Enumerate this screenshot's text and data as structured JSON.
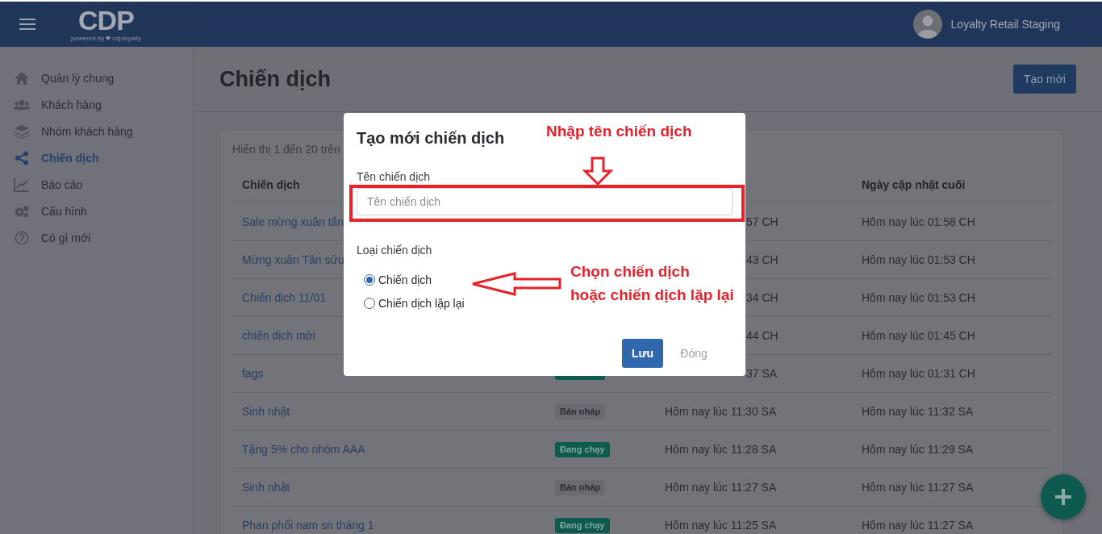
{
  "header": {
    "logo": "CDP",
    "tagline_prefix": "powered by",
    "tagline_brand": "cdployalty",
    "user": "Loyalty Retail Staging"
  },
  "sidebar": {
    "items": [
      {
        "label": "Quản lý chung",
        "selected": false
      },
      {
        "label": "Khách hàng",
        "selected": false
      },
      {
        "label": "Nhóm khách hàng",
        "selected": false
      },
      {
        "label": "Chiến dịch",
        "selected": true
      },
      {
        "label": "Báo cáo",
        "selected": false
      },
      {
        "label": "Cấu hình",
        "selected": false
      },
      {
        "label": "Có gì mới",
        "selected": false
      }
    ]
  },
  "page": {
    "title": "Chiến dịch",
    "create_button": "Tạo mới"
  },
  "table": {
    "summary": "Hiển thị 1 đến 20 trên",
    "columns": [
      "Chiến dịch",
      "",
      "",
      "Ngày cập nhật cuối"
    ],
    "rows": [
      {
        "name": "Sale mừng xuân tân",
        "created": "57 CH",
        "created_partial": true,
        "updated": "Hôm nay lúc 01:58 CH"
      },
      {
        "name": "Mừng xuân Tân sửu",
        "created": "43 CH",
        "created_partial": true,
        "updated": "Hôm nay lúc 01:53 CH"
      },
      {
        "name": "Chiến dịch 11/01",
        "created": "34 CH",
        "created_partial": true,
        "updated": "Hôm nay lúc 01:53 CH"
      },
      {
        "name": "chiến dịch mới",
        "created": "44 CH",
        "created_partial": true,
        "updated": "Hôm nay lúc 01:45 CH"
      },
      {
        "name": "fags",
        "status": {
          "kind": "running"
        },
        "created": "37 SA",
        "created_partial": true,
        "updated": "Hôm nay lúc 01:31 CH"
      },
      {
        "name": "Sinh nhật",
        "status": {
          "kind": "draft",
          "label": "Bản nháp"
        },
        "created": "Hôm nay lúc 11:30 SA",
        "created_partial": false,
        "updated": "Hôm nay lúc 11:32 SA"
      },
      {
        "name": "Tặng 5% cho nhóm AAA",
        "status": {
          "kind": "running",
          "label": "Đang chạy"
        },
        "created": "Hôm nay lúc 11:28 SA",
        "created_partial": false,
        "updated": "Hôm nay lúc 11:29 SA"
      },
      {
        "name": "Sinh nhật",
        "status": {
          "kind": "draft",
          "label": "Bản nháp"
        },
        "created": "Hôm nay lúc 11:27 SA",
        "created_partial": false,
        "updated": "Hôm nay lúc 11:27 SA"
      },
      {
        "name": "Phan phối nam sn tháng 1",
        "status": {
          "kind": "running",
          "label": "Đang chạy"
        },
        "created": "Hôm nay lúc 11:25 SA",
        "created_partial": false,
        "updated": "Hôm nay lúc 11:27 SA"
      }
    ]
  },
  "modal": {
    "title": "Tạo mới chiến dịch",
    "name_label": "Tên chiến dịch",
    "name_placeholder": "Tên chiến dịch",
    "type_label": "Loại chiến dịch",
    "options": [
      {
        "label": "Chiến dịch",
        "selected": true
      },
      {
        "label": "Chiến dịch lặp lại",
        "selected": false
      }
    ],
    "save_button": "Lưu",
    "close_button": "Đóng"
  },
  "annotations": {
    "input_note": "Nhập tên chiến dịch",
    "radio_note_lines": [
      "Chọn chiến dịch",
      "hoặc chiến dịch lặp lại"
    ]
  }
}
